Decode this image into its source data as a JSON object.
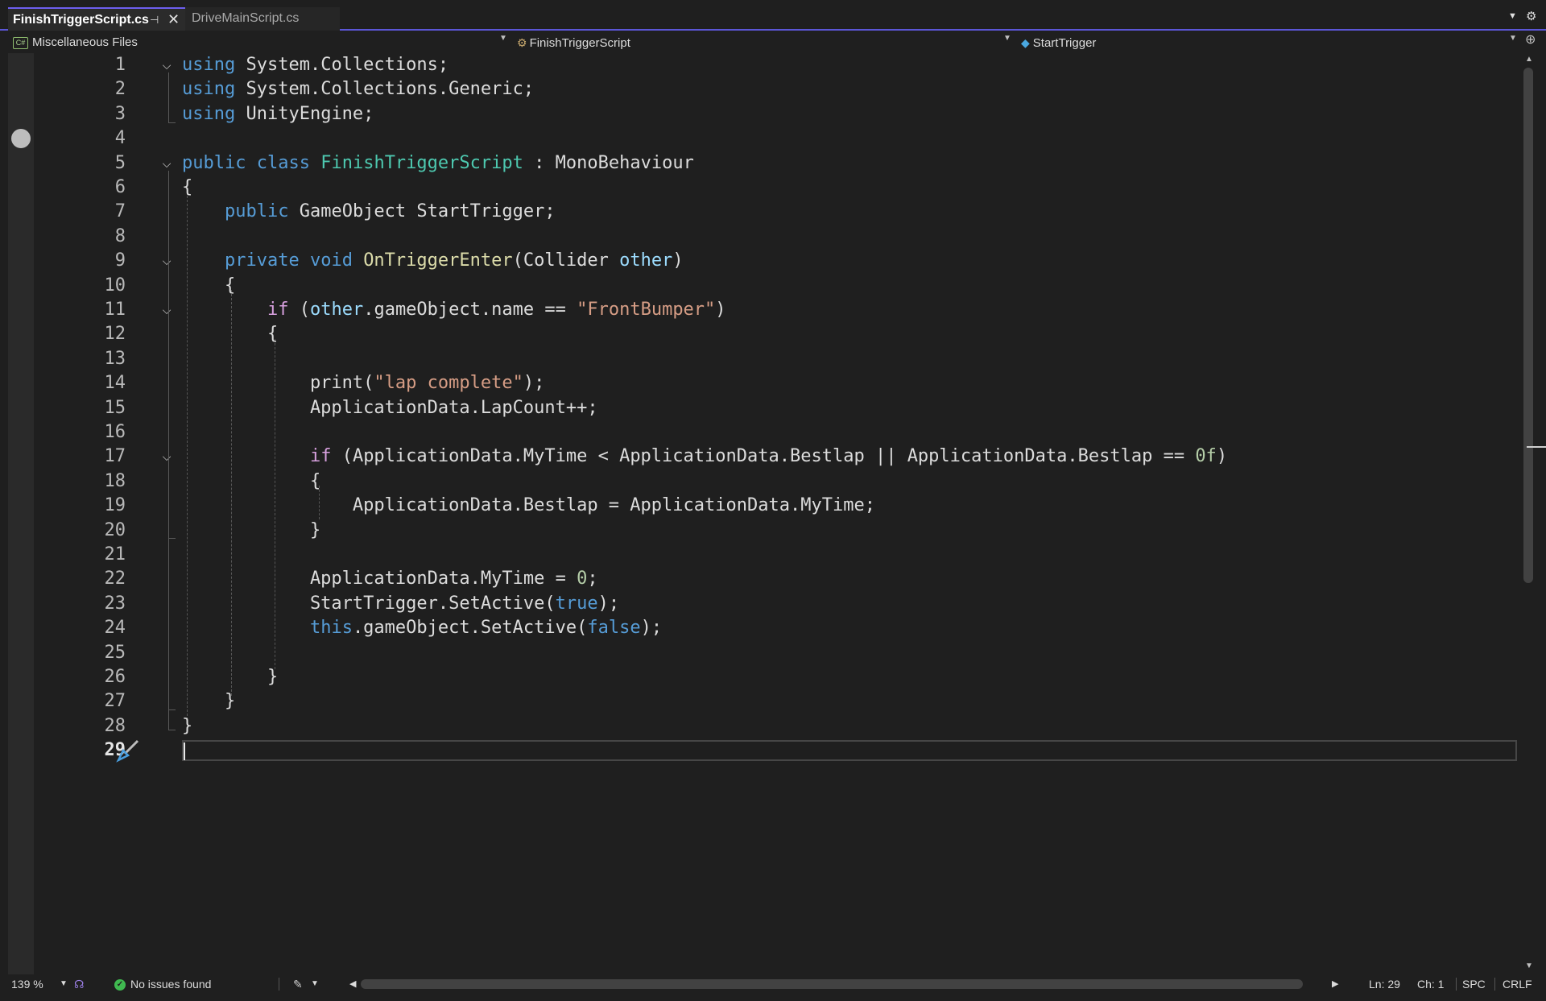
{
  "tabs": [
    {
      "label": "FinishTriggerScript.cs",
      "active": true
    },
    {
      "label": "DriveMainScript.cs",
      "active": false
    }
  ],
  "tab_icons": {
    "pin": "pin-icon",
    "close": "close-icon",
    "dropdown": "chevron-down-icon",
    "settings": "gear-icon"
  },
  "navbar": {
    "project": "Miscellaneous Files",
    "project_icon": "C#",
    "type": "FinishTriggerScript",
    "member": "StartTrigger"
  },
  "editor": {
    "line_numbers": [
      "1",
      "2",
      "3",
      "4",
      "5",
      "6",
      "7",
      "8",
      "9",
      "10",
      "11",
      "12",
      "13",
      "14",
      "15",
      "16",
      "17",
      "18",
      "19",
      "20",
      "21",
      "22",
      "23",
      "24",
      "25",
      "26",
      "27",
      "28",
      "29"
    ],
    "current_line": "29",
    "lines": [
      "using System.Collections;",
      "using System.Collections.Generic;",
      "using UnityEngine;",
      "",
      "public class FinishTriggerScript : MonoBehaviour",
      "{",
      "    public GameObject StartTrigger;",
      "",
      "    private void OnTriggerEnter(Collider other)",
      "    {",
      "        if (other.gameObject.name == \"FrontBumper\")",
      "        {",
      "",
      "            print(\"lap complete\");",
      "            ApplicationData.LapCount++;",
      "",
      "            if (ApplicationData.MyTime < ApplicationData.Bestlap || ApplicationData.Bestlap == 0f)",
      "            {",
      "                ApplicationData.Bestlap = ApplicationData.MyTime;",
      "            }",
      "",
      "            ApplicationData.MyTime = 0;",
      "            StartTrigger.SetActive(true);",
      "            this.gameObject.SetActive(false);",
      "",
      "        }",
      "    }",
      "}",
      ""
    ],
    "colors": {
      "keyword": "#569cd6",
      "control": "#d8a0df",
      "type": "#4ec9b0",
      "method": "#dcdcaa",
      "string": "#d69d85",
      "number": "#b5cea8",
      "parameter": "#9cdcfe"
    }
  },
  "statusbar": {
    "zoom": "139 %",
    "issues": "No issues found",
    "line": "Ln: 29",
    "col": "Ch: 1",
    "whitespace": "SPC",
    "line_ending": "CRLF"
  }
}
